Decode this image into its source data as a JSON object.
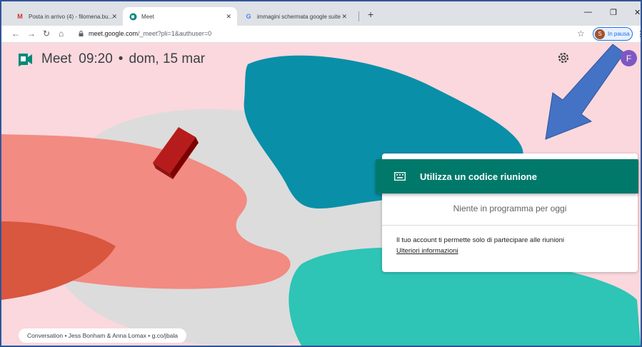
{
  "browser": {
    "tabs": [
      {
        "label": "Posta in arrivo (4) - filomena.bu...",
        "icon": "gmail-icon"
      },
      {
        "label": "Meet",
        "icon": "meet-icon"
      },
      {
        "label": "immagini schermata google suite",
        "icon": "google-icon"
      }
    ],
    "url_host": "meet.google.com",
    "url_path": "/_meet?pli=1&authuser=0",
    "profile_initial": "S",
    "profile_status": "In pausa"
  },
  "meet": {
    "title": "Meet",
    "time": "09:20",
    "separator": "•",
    "date": "dom, 15 mar",
    "avatar_initial": "F",
    "join_code_label": "Utilizza un codice riunione",
    "no_meetings": "Niente in programma per oggi",
    "account_notice": "Il tuo account ti permette solo di partecipare alle riunioni",
    "more_info": "Ulteriori informazioni",
    "credit": "Conversation • Jess Bonham & Anna Lomax • g.co/jbala"
  },
  "colors": {
    "page_bg": "#fad8de",
    "teal_button": "#00796b",
    "blue_shape": "#0a8fa8",
    "green_shape": "#2ec4b6",
    "coral_shape": "#f28b82",
    "arrow": "#4472c4"
  }
}
